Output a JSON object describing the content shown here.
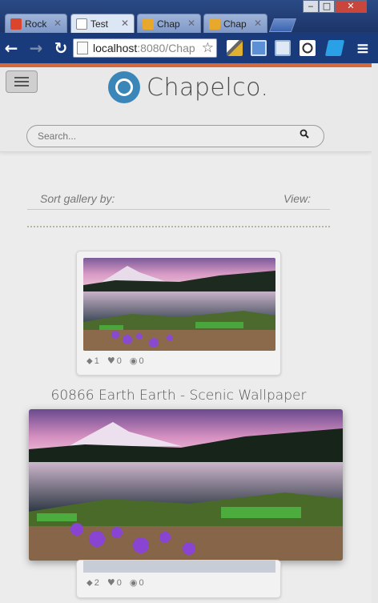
{
  "window_controls": {
    "minimize": "‒",
    "maximize": "□",
    "close": "✕"
  },
  "tabs": [
    {
      "label": "Rock",
      "color": "#d9462d"
    },
    {
      "label": "Test",
      "color": "#ffffff"
    },
    {
      "label": "Chap",
      "color": "#e7a82c"
    },
    {
      "label": "Chap",
      "color": "#e7a82c"
    }
  ],
  "address_bar": {
    "host": "localhost",
    "rest": ":8080/Chap"
  },
  "site": {
    "name": "Chapelco.",
    "search_placeholder": "Search...",
    "sort_label": "Sort gallery by:",
    "view_label": "View:"
  },
  "gallery": {
    "featured_title": "60866 Earth Earth - Scenic Wallpaper",
    "items": [
      {
        "tags": "1",
        "likes": "0",
        "views": "0"
      },
      {
        "tags": "2",
        "likes": "0",
        "views": "0"
      }
    ]
  },
  "colors": {
    "accent": "#d4693c",
    "brand": "#3b86b8"
  }
}
